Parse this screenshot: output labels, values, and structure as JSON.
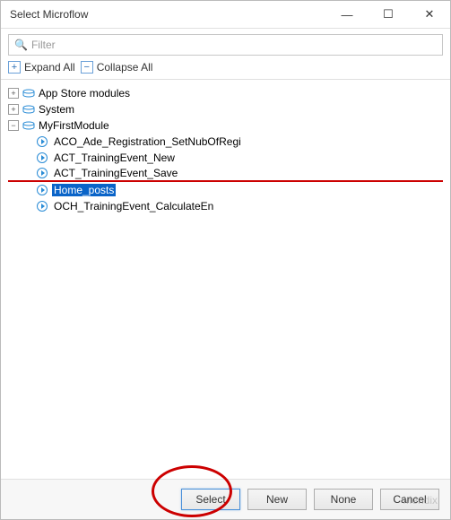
{
  "window": {
    "title": "Select Microflow"
  },
  "filter": {
    "placeholder": "Filter"
  },
  "toolbar": {
    "expand_all": "Expand All",
    "collapse_all": "Collapse All"
  },
  "tree": {
    "nodes": [
      {
        "label": "App Store modules",
        "type": "module",
        "expanded": false,
        "level": 0
      },
      {
        "label": "System",
        "type": "module",
        "expanded": false,
        "level": 0
      },
      {
        "label": "MyFirstModule",
        "type": "module",
        "expanded": true,
        "level": 0
      },
      {
        "label": "ACO_Ade_Registration_SetNubOfRegi",
        "type": "microflow",
        "level": 1
      },
      {
        "label": "ACT_TrainingEvent_New",
        "type": "microflow",
        "level": 1
      },
      {
        "label": "ACT_TrainingEvent_Save",
        "type": "microflow",
        "level": 1
      },
      {
        "label": "Home_posts",
        "type": "microflow",
        "level": 1,
        "selected": true
      },
      {
        "label": "OCH_TrainingEvent_CalculateEn",
        "type": "microflow",
        "level": 1
      }
    ]
  },
  "buttons": {
    "select": "Select",
    "new": "New",
    "none": "None",
    "cancel": "Cancel"
  },
  "watermark": "Mendix"
}
